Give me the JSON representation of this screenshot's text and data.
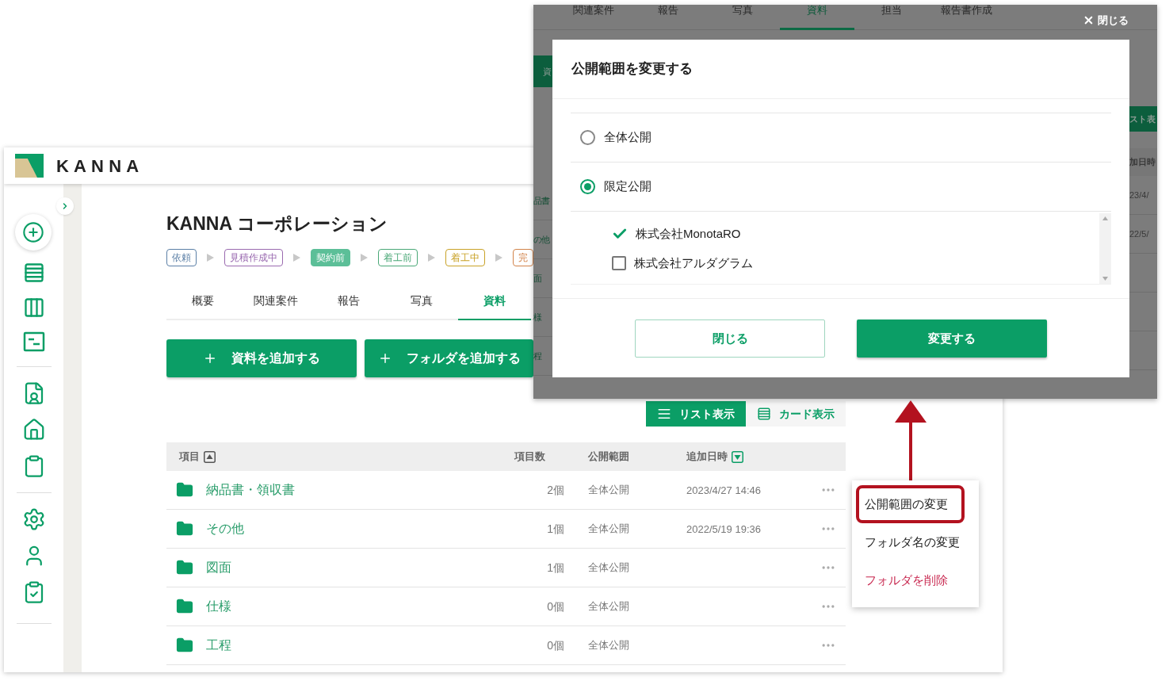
{
  "app": {
    "logo": "KANNA",
    "project_title": "KANNA コーポレーション",
    "stages": [
      {
        "label": "依頼",
        "color": "#5b7fa6",
        "selected": false
      },
      {
        "label": "見積作成中",
        "color": "#9a6ab0",
        "selected": false
      },
      {
        "label": "契約前",
        "color": "#5cbf98",
        "selected": true
      },
      {
        "label": "着工前",
        "color": "#4aa877",
        "selected": false
      },
      {
        "label": "着工中",
        "color": "#c9a227",
        "selected": false
      },
      {
        "label": "完",
        "color": "#d2834a",
        "selected": false
      }
    ],
    "tabs": [
      {
        "label": "概要",
        "selected": false
      },
      {
        "label": "関連案件",
        "selected": false
      },
      {
        "label": "報告",
        "selected": false
      },
      {
        "label": "写真",
        "selected": false
      },
      {
        "label": "資料",
        "selected": true
      }
    ],
    "actions": [
      {
        "label": "資料を追加する"
      },
      {
        "label": "フォルダを追加する"
      }
    ],
    "view_toggle": [
      {
        "label": "リスト表示",
        "kind": "list",
        "selected": true
      },
      {
        "label": "カード表示",
        "kind": "card",
        "selected": false
      }
    ],
    "table": {
      "columns": [
        {
          "label": "項目",
          "sorted": true,
          "ascending": true
        },
        {
          "label": "項目数",
          "sorted": false
        },
        {
          "label": "公開範囲",
          "sorted": false
        },
        {
          "label": "追加日時",
          "sorted": true,
          "ascending": false
        }
      ],
      "rows": [
        {
          "name": "納品書・領収書",
          "count": "2個",
          "visibility": "全体公開",
          "added": "2023/4/27 14:46"
        },
        {
          "name": "その他",
          "count": "1個",
          "visibility": "全体公開",
          "added": "2022/5/19 19:36"
        },
        {
          "name": "図面",
          "count": "1個",
          "visibility": "全体公開"
        },
        {
          "name": "仕様",
          "count": "0個",
          "visibility": "全体公開"
        },
        {
          "name": "工程",
          "count": "0個",
          "visibility": "全体公開"
        }
      ]
    }
  },
  "context_menu": {
    "items": [
      {
        "label": "公開範囲の変更",
        "kind": "normal",
        "highlighted": true
      },
      {
        "label": "フォルダ名の変更",
        "kind": "normal",
        "highlighted": false
      },
      {
        "label": "フォルダを削除",
        "kind": "danger",
        "highlighted": false
      }
    ]
  },
  "modal_screen": {
    "tabs": [
      {
        "label": "関連案件",
        "selected": false
      },
      {
        "label": "報告",
        "selected": false
      },
      {
        "label": "写真",
        "selected": false
      },
      {
        "label": "資料",
        "selected": true
      },
      {
        "label": "担当",
        "selected": false
      },
      {
        "label": "報告書作成",
        "selected": false
      }
    ],
    "close": "閉じる",
    "left_fragments": {
      "button": "資",
      "rows": [
        "品書",
        "の他",
        "面",
        "様",
        "程"
      ]
    },
    "right_fragments": {
      "button": "スト表",
      "header": "加日時",
      "rows": [
        "23/4/",
        "22/5/"
      ]
    },
    "dialog": {
      "title": "公開範囲を変更する",
      "options": [
        {
          "label": "全体公開",
          "selected": false
        },
        {
          "label": "限定公開",
          "selected": true
        }
      ],
      "companies": [
        {
          "name": "株式会社MonotaRO",
          "checked": true
        },
        {
          "name": "株式会社アルダグラム",
          "checked": false
        }
      ],
      "buttons": [
        {
          "label": "閉じる",
          "kind": "secondary"
        },
        {
          "label": "変更する",
          "kind": "primary"
        }
      ]
    }
  }
}
